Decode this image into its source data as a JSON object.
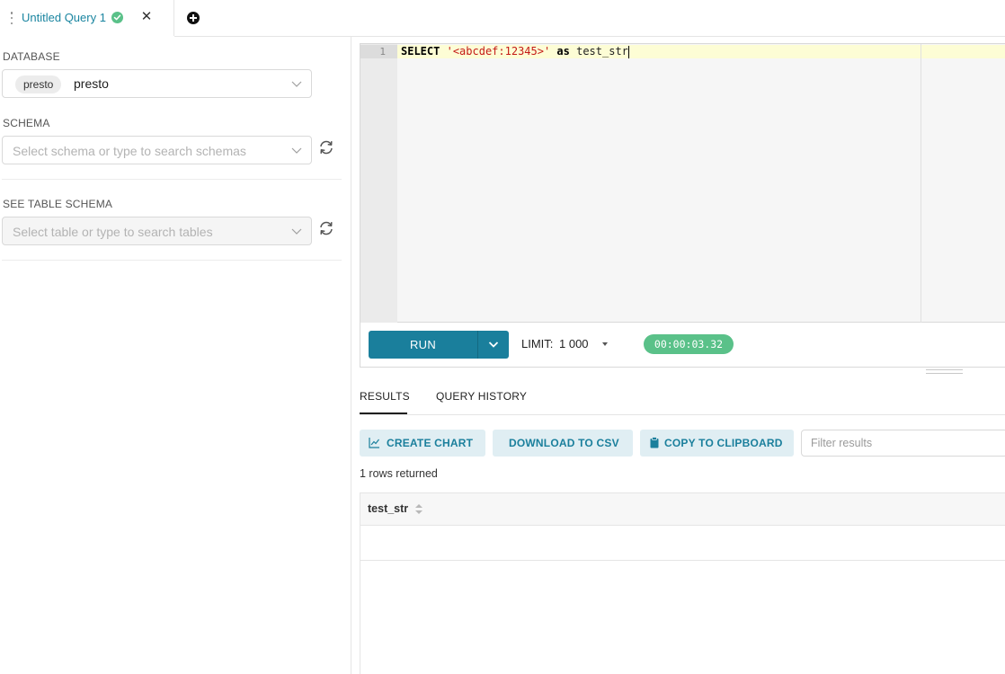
{
  "tabs": {
    "active_title": "Untitled Query 1",
    "status_color": "#5ac189"
  },
  "left_panel": {
    "database": {
      "label": "DATABASE",
      "chip": "presto",
      "value": "presto"
    },
    "schema": {
      "label": "SCHEMA",
      "placeholder": "Select schema or type to search schemas"
    },
    "table_schema": {
      "label": "SEE TABLE SCHEMA",
      "placeholder": "Select table or type to search tables"
    }
  },
  "editor": {
    "line_number": "1",
    "keyword_select": "SELECT",
    "string_literal": "'<abcdef:12345>'",
    "keyword_as": "as",
    "alias": "test_str"
  },
  "toolbar": {
    "run_label": "RUN",
    "limit_label": "LIMIT:",
    "limit_value": "1 000",
    "timer": "00:00:03.32",
    "accent_color": "#1a7f9c"
  },
  "results": {
    "tabs": [
      "RESULTS",
      "QUERY HISTORY"
    ],
    "buttons": {
      "create_chart": "CREATE CHART",
      "download_csv": "DOWNLOAD TO CSV",
      "copy_clipboard": "COPY TO CLIPBOARD"
    },
    "filter_placeholder": "Filter results",
    "rows_returned": "1 rows returned",
    "columns": [
      "test_str"
    ],
    "rows": [
      [
        ""
      ]
    ]
  }
}
